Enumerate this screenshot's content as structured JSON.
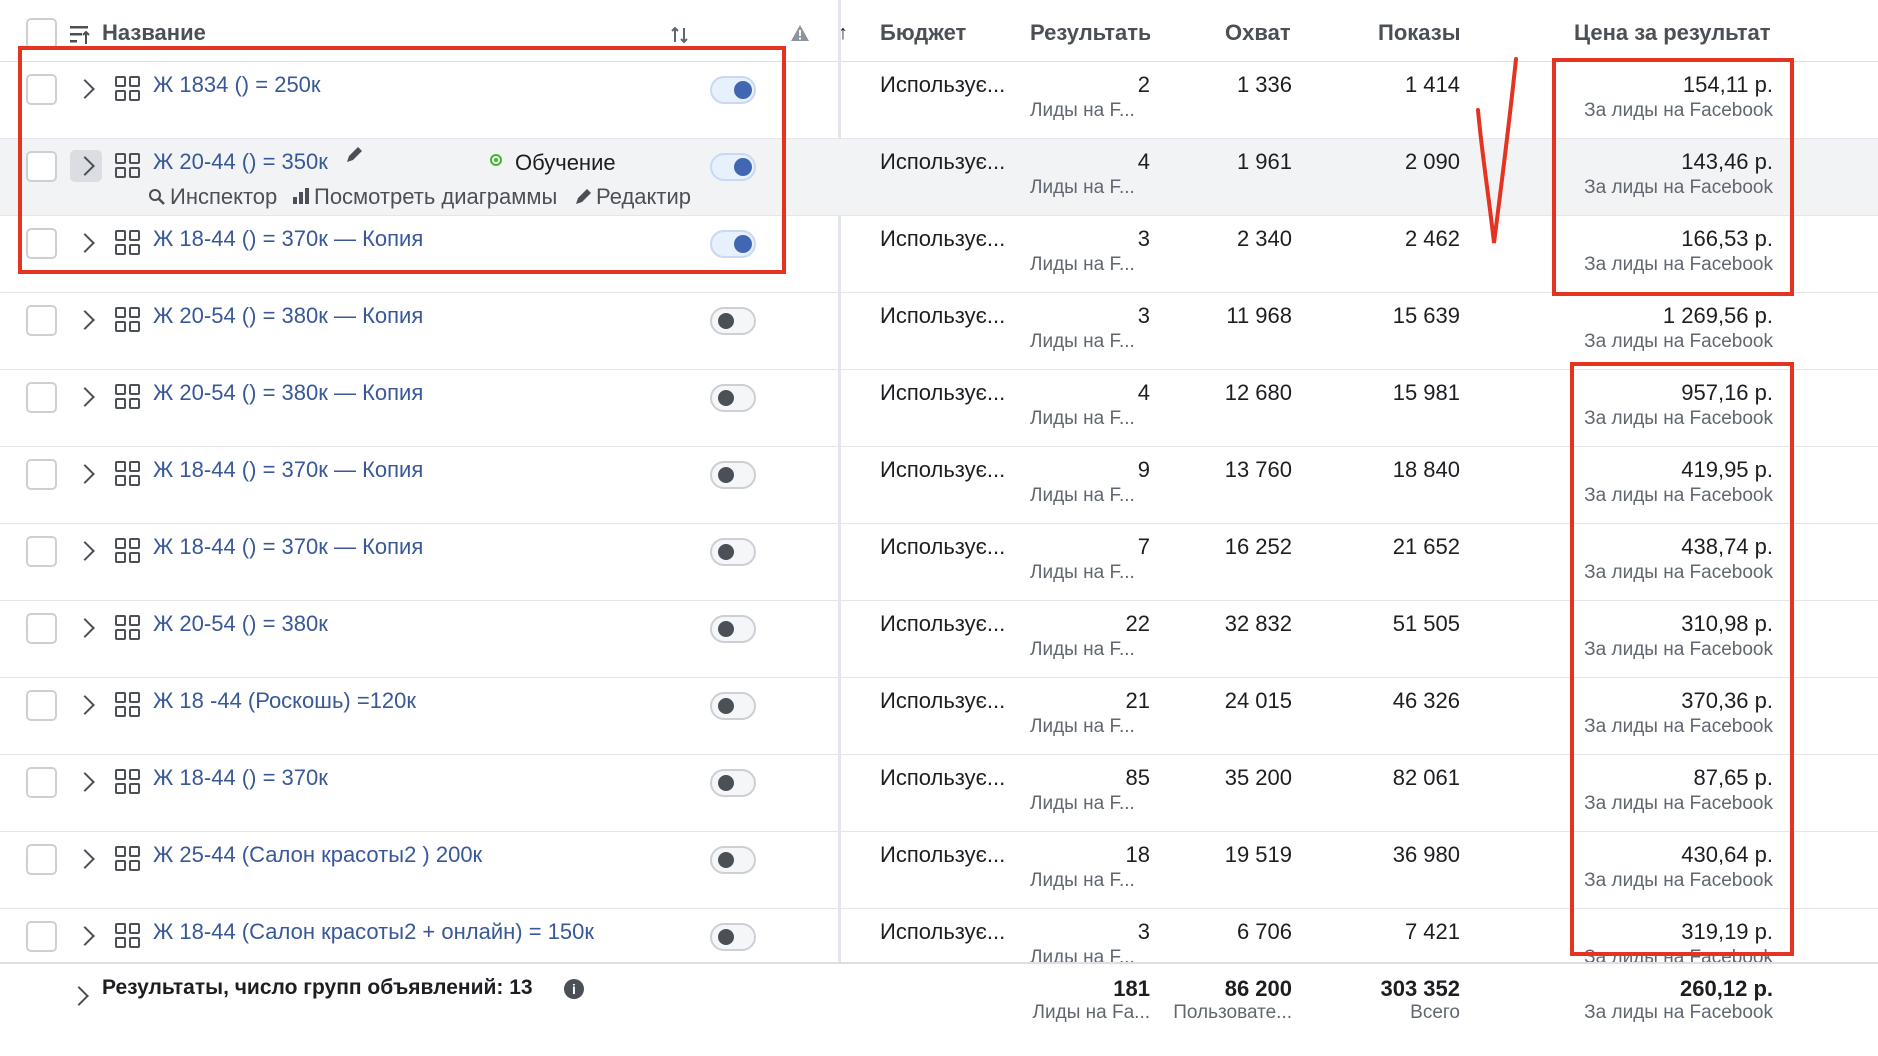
{
  "header": {
    "name_label": "Название",
    "sort_icon": "sort-arrows-icon",
    "warning_icon": "warning-icon",
    "up_arrow": "↑",
    "budget_label": "Бюджет",
    "results_label": "Результать",
    "reach_label": "Охват",
    "impressions_label": "Показы",
    "cost_label": "Цена за результат"
  },
  "hover_row": {
    "status_label": "Обучение",
    "action_inspector": "Инспектор",
    "action_charts": "Посмотреть диаграммы",
    "action_edit": "Редактир"
  },
  "rows": [
    {
      "name": "Ж 1834 () = 250к",
      "on": true,
      "budget": "Использує...",
      "results": "2",
      "results_sub": "Лиды на F...",
      "reach": "1 336",
      "impressions": "1 414",
      "cost": "154,11 р.",
      "cost_sub": "За лиды на Facebook"
    },
    {
      "name": "Ж 20-44 () = 350к",
      "on": true,
      "budget": "Использує...",
      "results": "4",
      "results_sub": "Лиды на F...",
      "reach": "1 961",
      "impressions": "2 090",
      "cost": "143,46 р.",
      "cost_sub": "За лиды на Facebook"
    },
    {
      "name": "Ж 18-44 () = 370к — Копия",
      "on": true,
      "budget": "Использує...",
      "results": "3",
      "results_sub": "Лиды на F...",
      "reach": "2 340",
      "impressions": "2 462",
      "cost": "166,53 р.",
      "cost_sub": "За лиды на Facebook"
    },
    {
      "name": "Ж 20-54 () = 380к — Копия",
      "on": false,
      "budget": "Использує...",
      "results": "3",
      "results_sub": "Лиды на F...",
      "reach": "11 968",
      "impressions": "15 639",
      "cost": "1 269,56 р.",
      "cost_sub": "За лиды на Facebook"
    },
    {
      "name": "Ж 20-54 () = 380к — Копия",
      "on": false,
      "budget": "Использує...",
      "results": "4",
      "results_sub": "Лиды на F...",
      "reach": "12 680",
      "impressions": "15 981",
      "cost": "957,16 р.",
      "cost_sub": "За лиды на Facebook"
    },
    {
      "name": "Ж 18-44 () = 370к — Копия",
      "on": false,
      "budget": "Использує...",
      "results": "9",
      "results_sub": "Лиды на F...",
      "reach": "13 760",
      "impressions": "18 840",
      "cost": "419,95 р.",
      "cost_sub": "За лиды на Facebook"
    },
    {
      "name": "Ж 18-44 () = 370к — Копия",
      "on": false,
      "budget": "Использує...",
      "results": "7",
      "results_sub": "Лиды на F...",
      "reach": "16 252",
      "impressions": "21 652",
      "cost": "438,74 р.",
      "cost_sub": "За лиды на Facebook"
    },
    {
      "name": "Ж 20-54 () = 380к",
      "on": false,
      "budget": "Использує...",
      "results": "22",
      "results_sub": "Лиды на F...",
      "reach": "32 832",
      "impressions": "51 505",
      "cost": "310,98 р.",
      "cost_sub": "За лиды на Facebook"
    },
    {
      "name": "Ж 18 -44 (Роскошь) =120к",
      "on": false,
      "budget": "Использує...",
      "results": "21",
      "results_sub": "Лиды на F...",
      "reach": "24 015",
      "impressions": "46 326",
      "cost": "370,36 р.",
      "cost_sub": "За лиды на Facebook"
    },
    {
      "name": "Ж 18-44 () = 370к",
      "on": false,
      "budget": "Использує...",
      "results": "85",
      "results_sub": "Лиды на F...",
      "reach": "35 200",
      "impressions": "82 061",
      "cost": "87,65 р.",
      "cost_sub": "За лиды на Facebook"
    },
    {
      "name": "Ж 25-44 (Салон красоты2 ) 200к",
      "on": false,
      "budget": "Использує...",
      "results": "18",
      "results_sub": "Лиды на F...",
      "reach": "19 519",
      "impressions": "36 980",
      "cost": "430,64 р.",
      "cost_sub": "За лиды на Facebook"
    },
    {
      "name": "Ж 18-44 (Салон красоты2 + онлайн) = 150к",
      "on": false,
      "budget": "Использує...",
      "results": "3",
      "results_sub": "Лиды на F...",
      "reach": "6 706",
      "impressions": "7 421",
      "cost": "319,19 р.",
      "cost_sub": "За лиды на Facebook"
    }
  ],
  "footer": {
    "label": "Результаты, число групп объявлений: 13",
    "results": "181",
    "results_sub": "Лиды на Fa...",
    "reach": "86 200",
    "reach_sub": "Пользовате...",
    "impressions": "303 352",
    "impressions_sub": "Всего",
    "cost": "260,12 р.",
    "cost_sub": "За лиды на Facebook"
  },
  "colors": {
    "link": "#385898",
    "annotation_red": "#e53322",
    "toggle_on": "#4267b2",
    "learning_dot": "#42b72a"
  }
}
